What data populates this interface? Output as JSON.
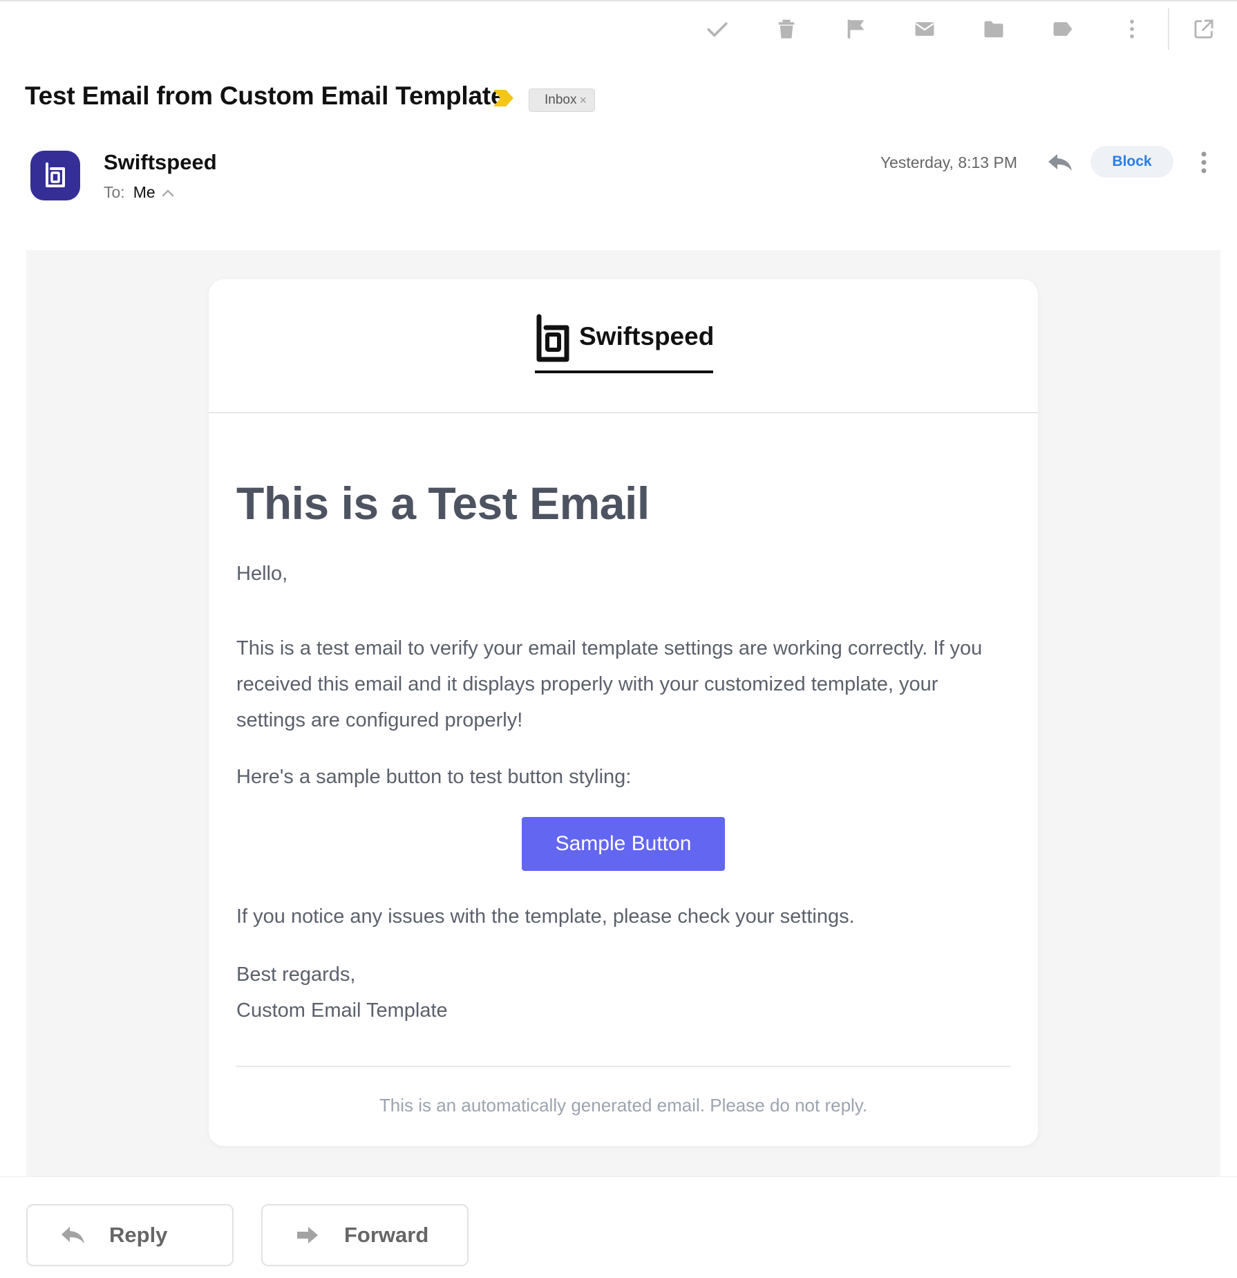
{
  "toolbar": {
    "icons": [
      "checkmark-icon",
      "trash-icon",
      "flag-icon",
      "envelope-icon",
      "folder-icon",
      "label-icon",
      "more-vertical-icon",
      "open-external-icon"
    ]
  },
  "message": {
    "subject": "Test Email from Custom Email Template",
    "importance_color": "#f5c518",
    "label_chip": "Inbox",
    "label_remove": "×",
    "sender": {
      "name": "Swiftspeed",
      "avatar_color": "#342e96",
      "to_label": "To:",
      "to_value": "Me"
    },
    "timestamp": "Yesterday, 8:13 PM",
    "block_label": "Block"
  },
  "email": {
    "brand_name": "Swiftspeed",
    "title": "This is a Test Email",
    "greeting": "Hello,",
    "body": "This is a test email to verify your email template settings are working correctly. If you received this email and it displays properly with your customized template, your settings are configured properly!",
    "sample_intro": "Here's a sample button to test button styling:",
    "button_label": "Sample Button",
    "button_color": "#6366f1",
    "notice": "If you notice any issues with the template, please check your settings.",
    "regards": "Best regards,",
    "signature": "Custom Email Template",
    "footer": "This is an automatically generated email. Please do not reply."
  },
  "actions": {
    "reply": "Reply",
    "forward": "Forward"
  }
}
